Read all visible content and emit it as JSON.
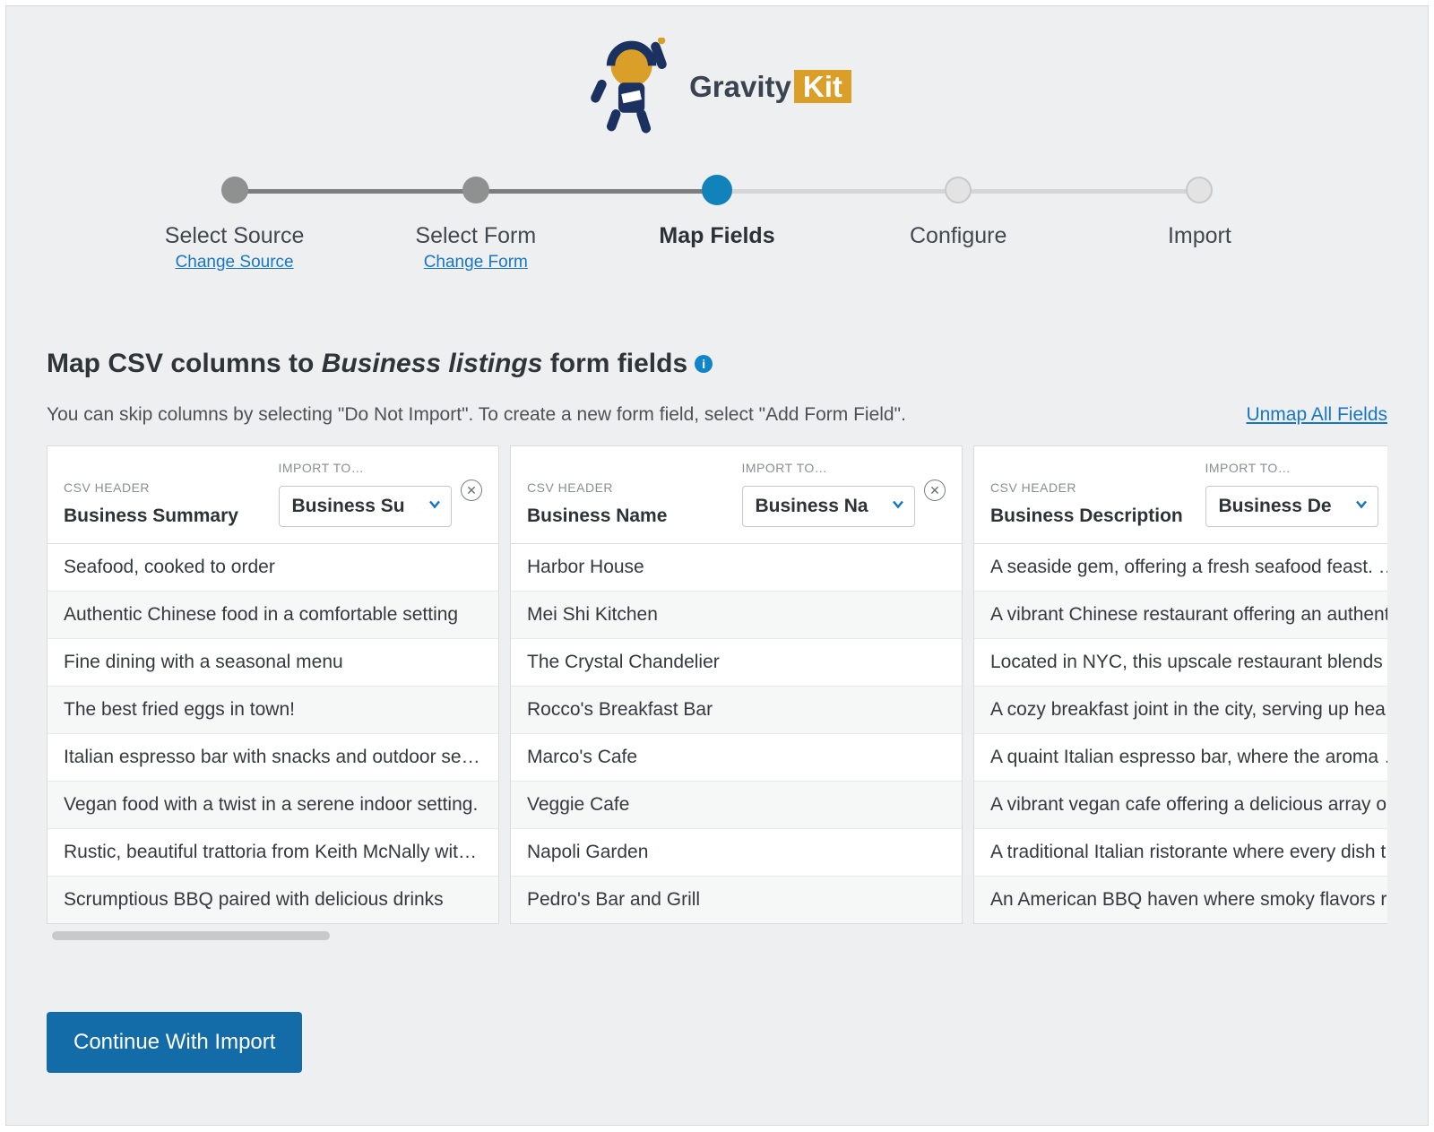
{
  "brand": {
    "gravity": "Gravity",
    "kit": "Kit"
  },
  "stepper": {
    "steps": [
      {
        "label": "Select Source",
        "sublink": "Change Source"
      },
      {
        "label": "Select Form",
        "sublink": "Change Form"
      },
      {
        "label": "Map Fields"
      },
      {
        "label": "Configure"
      },
      {
        "label": "Import"
      }
    ]
  },
  "title": {
    "pre": "Map CSV columns to ",
    "form_name": "Business listings",
    "post": " form fields"
  },
  "subhead": "You can skip columns by selecting \"Do Not Import\". To create a new form field, select \"Add Form Field\".",
  "unmap_link": "Unmap All Fields",
  "labels": {
    "csv_header": "CSV HEADER",
    "import_to": "IMPORT TO…"
  },
  "columns": [
    {
      "header": "Business Summary",
      "mapped": "Business Su",
      "rows": [
        "Seafood, cooked to order",
        "Authentic Chinese food in a comfortable setting",
        "Fine dining with a seasonal menu",
        "The best fried eggs in town!",
        "Italian espresso bar with snacks and outdoor seati...",
        "Vegan food with a twist in a serene indoor setting.",
        "Rustic, beautiful trattoria from Keith McNally with ...",
        "Scrumptious BBQ paired with delicious drinks"
      ]
    },
    {
      "header": "Business Name",
      "mapped": "Business Na",
      "rows": [
        "Harbor House",
        "Mei Shi Kitchen",
        "The Crystal Chandelier",
        "Rocco's Breakfast Bar",
        "Marco's Cafe",
        "Veggie Cafe",
        "Napoli Garden",
        "Pedro's Bar and Grill"
      ]
    },
    {
      "header": "Business Description",
      "mapped": "Business De",
      "rows": [
        "A seaside gem, offering a fresh seafood feast. Div...",
        "A vibrant Chinese restaurant offering an authentic...",
        "Located in NYC, this upscale restaurant blends ex...",
        "A cozy breakfast joint in the city, serving up heart...",
        "A quaint Italian espresso bar, where the aroma of r.",
        "A vibrant vegan cafe offering a delicious array of ...",
        "A traditional Italian ristorante where every dish tell...",
        "An American BBQ haven where smoky flavors reig..."
      ]
    }
  ],
  "continue_label": "Continue With Import"
}
